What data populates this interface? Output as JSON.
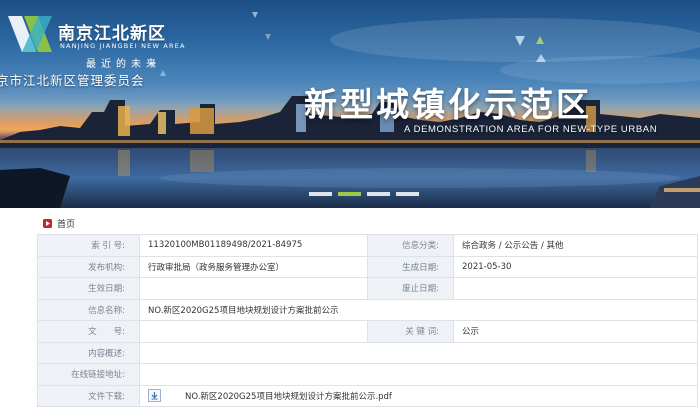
{
  "colors": {
    "accent_green": "#9ec84a",
    "label_bg": "#eef1f6",
    "border": "#dde2ea",
    "home_icon": "#c0282d"
  },
  "banner": {
    "logo": {
      "title": "南京江北新区",
      "subtitle_en": "NANJING JIANGBEI NEW AREA",
      "slogan": "最近的未来"
    },
    "org_name": "京市江北新区管理委员会",
    "headline": "新型城镇化示范区",
    "subheadline": "A DEMONSTRATION AREA FOR NEW-TYPE URBAN",
    "slides_count": 4,
    "active_slide": 2
  },
  "breadcrumb": {
    "icon": "home-icon",
    "label": "首页"
  },
  "info": {
    "index_no_label": "索 引 号:",
    "index_no": "11320100MB01189498/2021-84975",
    "category_label": "信息分类:",
    "category": "综合政务 / 公示公告 / 其他",
    "publisher_label": "发布机构:",
    "publisher": "行政审批局（政务服务管理办公室）",
    "created_label": "生成日期:",
    "created": "2021-05-30",
    "effective_label": "生效日期:",
    "effective": "",
    "expiry_label": "废止日期:",
    "expiry": "",
    "name_label": "信息名称:",
    "name": "NO.新区2020G25项目地块规划设计方案批前公示",
    "doc_no_label": "文　　号:",
    "doc_no": "",
    "keywords_label": "关 键 词:",
    "keywords": "公示",
    "summary_label": "内容概述:",
    "summary": "",
    "online_link_label": "在线链接地址:",
    "online_link": "",
    "download_label": "文件下载:",
    "download_icon": "download-icon",
    "download_file": "NO.新区2020G25项目地块规划设计方案批前公示.pdf"
  }
}
